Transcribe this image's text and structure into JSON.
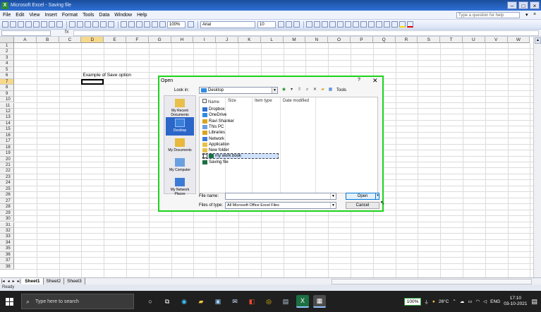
{
  "window": {
    "title": "Microsoft Excel - Saving file",
    "app_icon": "X"
  },
  "menu": {
    "items": [
      "File",
      "Edit",
      "View",
      "Insert",
      "Format",
      "Tools",
      "Data",
      "Window",
      "Help"
    ],
    "help_placeholder": "Type a question for help"
  },
  "toolbar": {
    "zoom": "100%",
    "font": "Arial",
    "size": "10"
  },
  "formula": {
    "fx": "fx"
  },
  "grid": {
    "columns": [
      "A",
      "B",
      "C",
      "D",
      "E",
      "F",
      "G",
      "H",
      "I",
      "J",
      "K",
      "L",
      "M",
      "N",
      "O",
      "P",
      "Q",
      "R",
      "S",
      "T",
      "U",
      "V",
      "W"
    ],
    "active_column": "D",
    "active_row": 7,
    "rows": 38,
    "cell_text": "Example of Save option"
  },
  "sheets": [
    "Sheet1",
    "Sheet2",
    "Sheet3"
  ],
  "status": "Ready",
  "dialog": {
    "title": "Open",
    "help": "?",
    "close": "✕",
    "look_in_label": "Look in:",
    "look_in_value": "Desktop",
    "tools_label": "Tools",
    "places": [
      "My Recent Documents",
      "Desktop",
      "My Documents",
      "My Computer",
      "My Network Places"
    ],
    "columns": [
      "Name",
      "Size",
      "Item type",
      "Date modified"
    ],
    "files": [
      "Dropbox",
      "OneDrive",
      "Ravi Shanker",
      "This PC",
      "Libraries",
      "Network",
      "Application",
      "New folder",
      "my work book",
      "Saving file"
    ],
    "selected_file": "my work book",
    "file_name_label": "File name:",
    "file_name_value": "",
    "file_type_label": "Files of type:",
    "file_type_value": "All Microsoft Office Excel Files",
    "open_label": "Open",
    "cancel_label": "Cancel"
  },
  "taskbar": {
    "search_placeholder": "Type here to search",
    "battery": "100%",
    "temperature": "26°C",
    "language": "ENG",
    "time": "17:10",
    "date": "03-10-2021"
  }
}
